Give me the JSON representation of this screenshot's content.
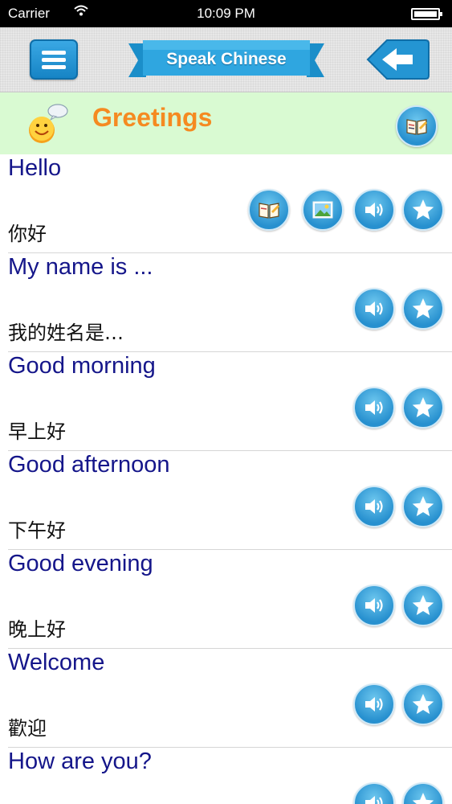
{
  "status_bar": {
    "carrier": "Carrier",
    "time": "10:09 PM"
  },
  "nav": {
    "title": "Speak Chinese",
    "menu_icon": "hamburger-icon",
    "back_icon": "back-arrow-icon"
  },
  "header": {
    "title": "Greetings",
    "icon": "smiley-icon",
    "action_icon": "phrasebook-icon"
  },
  "colors": {
    "accent_blue": "#2790cf",
    "title_orange": "#f58a21",
    "phrase_blue": "#15168a",
    "header_green": "#d9fad2"
  },
  "phrases": [
    {
      "english": "Hello",
      "chinese": "你好"
    },
    {
      "english": "My name is ...",
      "chinese": "我的姓名是…"
    },
    {
      "english": "Good morning",
      "chinese": "早上好"
    },
    {
      "english": "Good afternoon",
      "chinese": "下午好"
    },
    {
      "english": "Good evening",
      "chinese": "晚上好"
    },
    {
      "english": "Welcome",
      "chinese": "歡迎"
    },
    {
      "english": "How are you?",
      "chinese": ""
    }
  ]
}
